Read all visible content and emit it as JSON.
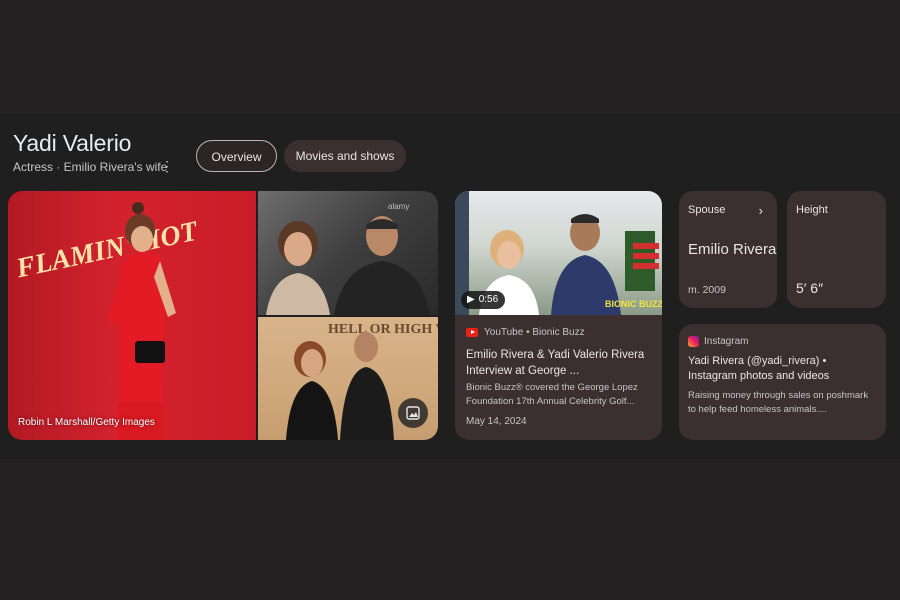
{
  "entity": {
    "title": "Yadi Valerio",
    "subtitle": "Actress · Emilio Rivera's wife"
  },
  "tabs": [
    {
      "label": "Overview",
      "active": true
    },
    {
      "label": "Movies and shows",
      "active": false
    }
  ],
  "images": {
    "main_caption": "Robin L Marshall/Getty Images",
    "main_sign_text": "FLAMIN' HOT",
    "top_watermark": "alamy",
    "bottom_sign_text": "HELL OR HIGH WATER"
  },
  "video": {
    "duration": "0:56",
    "source": "YouTube • Bionic Buzz",
    "title": "Emilio Rivera & Yadi Valerio Rivera Interview at George ...",
    "description": "Bionic Buzz® covered the George Lopez Foundation 17th Annual Celebrity Golf...",
    "date": "May 14, 2024",
    "thumb_text": "BIONIC BUZZ"
  },
  "facts": {
    "spouse": {
      "label": "Spouse",
      "value": "Emilio Rivera",
      "sub": "m. 2009"
    },
    "height": {
      "label": "Height",
      "value": "5′ 6″"
    }
  },
  "instagram": {
    "source": "Instagram",
    "title": "Yadi Rivera (@yadi_rivera) • Instagram photos and videos",
    "description": "Raising money through sales on poshmark to help feed homeless animals...."
  },
  "colors": {
    "page_bg": "#242122",
    "panel_bg": "#1f1f1f",
    "card_bg": "#3b2f30",
    "youtube_red": "#e62117"
  }
}
